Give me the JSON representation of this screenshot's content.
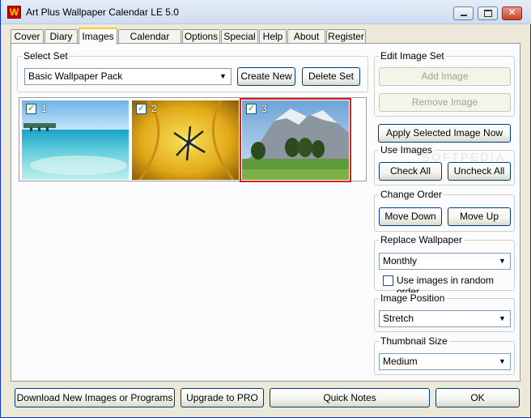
{
  "window": {
    "title": "Art Plus Wallpaper Calendar LE 5.0",
    "icon_letter": "W",
    "icon": "app-logo-icon",
    "controls": [
      "minimize-icon",
      "maximize-icon",
      "close-icon"
    ],
    "close_glyph": "✕"
  },
  "tabs": [
    {
      "label": "Cover"
    },
    {
      "label": "Diary"
    },
    {
      "label": "Images",
      "active": true
    },
    {
      "label": "Calendar Style"
    },
    {
      "label": "Options"
    },
    {
      "label": "Special"
    },
    {
      "label": "Help"
    },
    {
      "label": "About"
    },
    {
      "label": "Register"
    }
  ],
  "select_set": {
    "label": "Select Set",
    "value": "Basic Wallpaper Pack",
    "create_label": "Create New",
    "delete_label": "Delete Set"
  },
  "thumbnails": [
    {
      "number": "1",
      "checked": true,
      "subject": "beach"
    },
    {
      "number": "2",
      "checked": true,
      "subject": "tulip"
    },
    {
      "number": "3",
      "checked": true,
      "subject": "mountain",
      "selected": true
    }
  ],
  "edit_image_set": {
    "label": "Edit Image Set",
    "add_label": "Add Image",
    "remove_label": "Remove Image"
  },
  "apply_label": "Apply Selected Image Now",
  "use_images": {
    "label": "Use Images",
    "check_all": "Check All",
    "uncheck_all": "Uncheck All"
  },
  "change_order": {
    "label": "Change Order",
    "down": "Move Down",
    "up": "Move Up"
  },
  "replace_wallpaper": {
    "label": "Replace Wallpaper",
    "value": "Monthly",
    "random_label": "Use images in random order",
    "random_checked": false
  },
  "image_position": {
    "label": "Image Position",
    "value": "Stretch"
  },
  "thumbnail_size": {
    "label": "Thumbnail Size",
    "value": "Medium"
  },
  "bottom": {
    "download": "Download New Images or Programs",
    "upgrade": "Upgrade to PRO",
    "quick_notes": "Quick Notes",
    "ok": "OK"
  },
  "watermark": "SOFTPEDIA"
}
